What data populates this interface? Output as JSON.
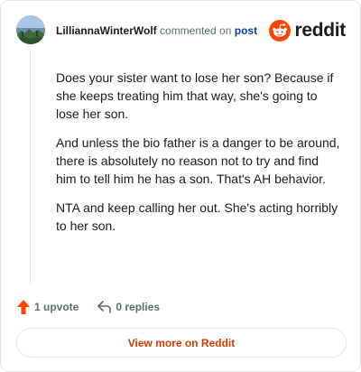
{
  "header": {
    "username": "LilliannaWinterWolf",
    "action": "commented on",
    "post_link": "post",
    "brand": "reddit",
    "avatar_icon": "landscape-avatar-icon",
    "logo_icon": "reddit-snoo-icon"
  },
  "comment": {
    "paragraphs": [
      "Does your sister want to lose her son? Because if she keeps treating him that way, she's going to lose her son.",
      "And unless the bio father is a danger to be around, there is absolutely no reason not to try and find him to tell him he has a son. That's AH behavior.",
      "NTA and keep calling her out. She's acting horribly to her son."
    ]
  },
  "footer": {
    "upvotes": "1 upvote",
    "replies": "0 replies",
    "upvote_icon": "upvote-arrow-icon",
    "reply_icon": "reply-arrow-icon"
  },
  "view_more_label": "View more on Reddit",
  "colors": {
    "accent": "#d93a00",
    "reddit_orange": "#ff4500",
    "link_blue": "#0a449b",
    "muted": "#576f76"
  }
}
